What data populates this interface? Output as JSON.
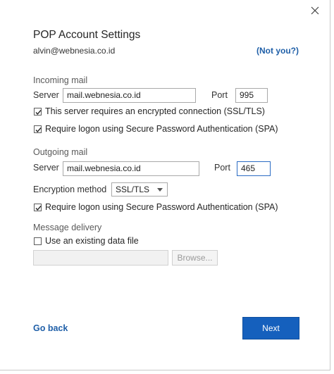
{
  "dialog": {
    "title": "POP Account Settings",
    "email": "alvin@webnesia.co.id",
    "not_you_link": "(Not you?)",
    "close_icon": "close-icon"
  },
  "incoming": {
    "section_label": "Incoming mail",
    "server_label": "Server",
    "server_value": "mail.webnesia.co.id",
    "port_label": "Port",
    "port_value": "995",
    "ssl_checkbox_label": "This server requires an encrypted connection (SSL/TLS)",
    "ssl_checked": true,
    "spa_checkbox_label": "Require logon using Secure Password Authentication (SPA)",
    "spa_checked": true
  },
  "outgoing": {
    "section_label": "Outgoing mail",
    "server_label": "Server",
    "server_value": "mail.webnesia.co.id",
    "port_label": "Port",
    "port_value": "465",
    "encryption_label": "Encryption method",
    "encryption_value": "SSL/TLS",
    "spa_checkbox_label": "Require logon using Secure Password Authentication (SPA)",
    "spa_checked": true
  },
  "delivery": {
    "section_label": "Message delivery",
    "existing_file_label": "Use an existing data file",
    "existing_file_checked": false,
    "file_path_value": "",
    "browse_label": "Browse..."
  },
  "footer": {
    "go_back_label": "Go back",
    "next_label": "Next"
  },
  "colors": {
    "accent": "#1560bd",
    "link": "#1f5fa8",
    "focus_border": "#2b6cc4"
  }
}
